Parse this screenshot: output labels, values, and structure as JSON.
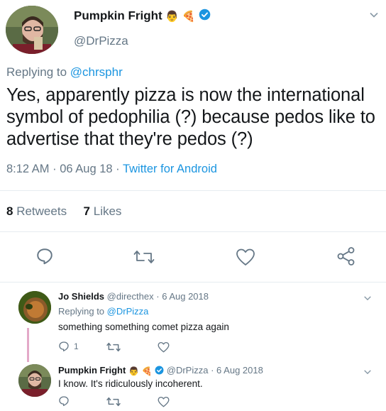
{
  "main_tweet": {
    "author_name": "Pumpkin Fright",
    "author_handle": "@DrPizza",
    "replying_prefix": "Replying to ",
    "replying_to": "@chrsphr",
    "text": "Yes, apparently pizza is now the international symbol of pedophilia (?) because pedos like to advertise that they're pedos (?)",
    "time": "8:12 AM",
    "date": "06 Aug 18",
    "dot": "·",
    "source": "Twitter for Android",
    "retweets_count": "8",
    "retweets_label": "Retweets",
    "likes_count": "7",
    "likes_label": "Likes"
  },
  "replies": [
    {
      "author_name": "Jo Shields",
      "author_handle": "@directhex",
      "date": "6 Aug 2018",
      "replying_prefix": "Replying to ",
      "replying_to": "@DrPizza",
      "text": "something something comet pizza again",
      "reply_count": "1"
    },
    {
      "author_name": "Pumpkin Fright",
      "author_handle": "@DrPizza",
      "date": "6 Aug 2018",
      "text": "I know. It's ridiculously incoherent."
    }
  ],
  "emojis": {
    "person": "👨",
    "pizza": "🍕"
  },
  "colors": {
    "accent": "#1b95e0",
    "muted": "#657786",
    "thread_line": "#e3a9c8",
    "divider": "#e6ecf0"
  }
}
